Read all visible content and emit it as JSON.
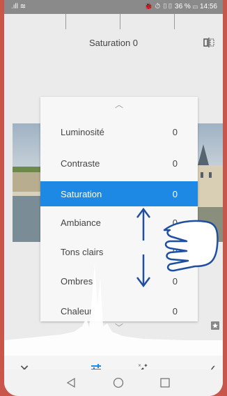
{
  "status": {
    "left": ".ıll ≋",
    "right": "🐞 ⏱ ▯▯ 36 % ▭ 14:56"
  },
  "header": {
    "title": "Saturation 0",
    "compare_icon": "compare-split-icon"
  },
  "menu": {
    "items": [
      {
        "label": "Luminosité",
        "value": "0"
      },
      {
        "label": "Contraste",
        "value": "0"
      },
      {
        "label": "Saturation",
        "value": "0"
      },
      {
        "label": "Ambiance",
        "value": "0"
      },
      {
        "label": "Tons clairs",
        "value": "0"
      },
      {
        "label": "Ombres",
        "value": "0"
      },
      {
        "label": "Chaleur",
        "value": "0"
      }
    ],
    "selected_index": 2,
    "accent": "#1e88e5"
  },
  "toolbar": {
    "cancel_icon": "close-icon",
    "tune_icon": "tune-sliders-icon",
    "auto_icon": "magic-wand-icon",
    "apply_icon": "check-icon"
  },
  "navbar": {
    "back_icon": "back-triangle-icon",
    "home_icon": "home-circle-icon",
    "recents_icon": "recents-square-icon"
  }
}
